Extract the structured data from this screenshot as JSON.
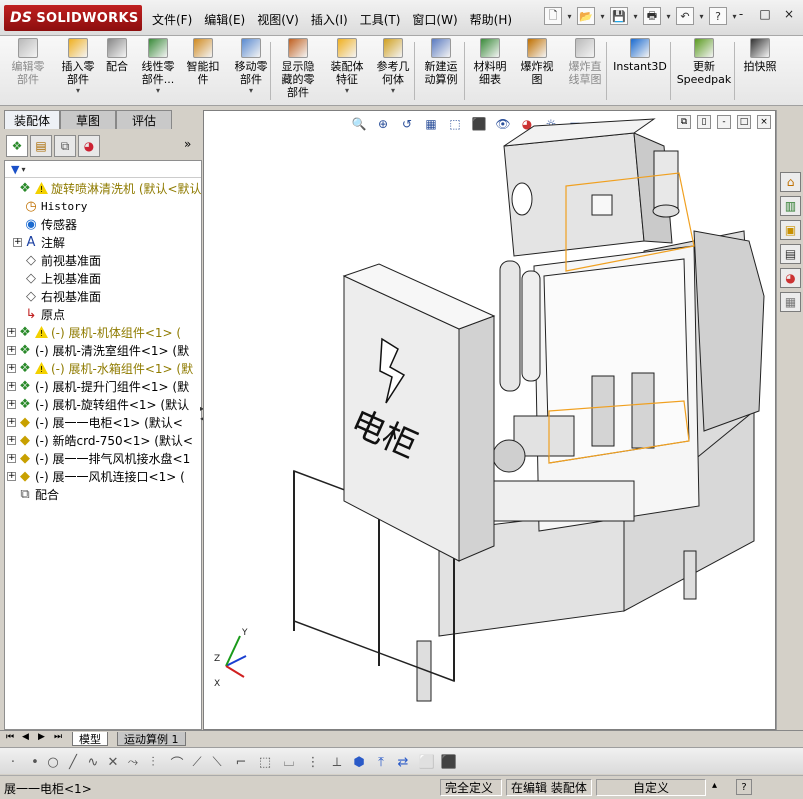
{
  "app": {
    "logo_text": "SOLIDWORKS",
    "logo_ds": "DS"
  },
  "menu": [
    "文件(F)",
    "编辑(E)",
    "视图(V)",
    "插入(I)",
    "工具(T)",
    "窗口(W)",
    "帮助(H)"
  ],
  "quick_icons": [
    "new-document-icon",
    "open-folder-icon",
    "save-icon",
    "print-icon",
    "undo-icon",
    "help-icon"
  ],
  "window_controls": [
    "?",
    "-",
    "□",
    "×"
  ],
  "command_manager": [
    {
      "label": "编辑零\n部件",
      "disabled": true,
      "dropdown": false
    },
    {
      "label": "插入零\n部件",
      "disabled": false,
      "dropdown": true
    },
    {
      "label": "配合",
      "disabled": false,
      "dropdown": false
    },
    {
      "label": "线性零\n部件...",
      "disabled": false,
      "dropdown": true
    },
    {
      "label": "智能扣\n件",
      "disabled": false,
      "dropdown": false
    },
    {
      "label": "移动零\n部件",
      "disabled": false,
      "dropdown": true
    },
    {
      "label": "显示隐\n藏的零\n部件",
      "disabled": false,
      "dropdown": false
    },
    {
      "label": "装配体\n特征",
      "disabled": false,
      "dropdown": true
    },
    {
      "label": "参考几\n何体",
      "disabled": false,
      "dropdown": true
    },
    {
      "label": "新建运\n动算例",
      "disabled": false,
      "dropdown": false
    },
    {
      "label": "材料明\n细表",
      "disabled": false,
      "dropdown": false
    },
    {
      "label": "爆炸视\n图",
      "disabled": false,
      "dropdown": false
    },
    {
      "label": "爆炸直\n线草图",
      "disabled": true,
      "dropdown": false
    },
    {
      "label": "Instant3D",
      "disabled": false,
      "dropdown": false
    },
    {
      "label": "更新\nSpeedpak",
      "disabled": false,
      "dropdown": false
    },
    {
      "label": "拍快照",
      "disabled": false,
      "dropdown": false
    }
  ],
  "left_tabs": [
    "装配体",
    "草图",
    "评估"
  ],
  "panel_more": "»",
  "tree": [
    {
      "label": "旋转喷淋清洗机  (默认<默认",
      "icon": "assembly-icon",
      "warn": true,
      "expand": false,
      "indent": 0,
      "style": "ylw"
    },
    {
      "label": "History",
      "icon": "history-icon",
      "warn": false,
      "expand": false,
      "indent": 1,
      "style": "mono"
    },
    {
      "label": "传感器",
      "icon": "sensor-icon",
      "warn": false,
      "expand": false,
      "indent": 1,
      "style": ""
    },
    {
      "label": "注解",
      "icon": "annotation-icon",
      "warn": false,
      "expand": true,
      "indent": 1,
      "style": ""
    },
    {
      "label": "前视基准面",
      "icon": "plane-icon",
      "warn": false,
      "expand": false,
      "indent": 1,
      "style": ""
    },
    {
      "label": "上视基准面",
      "icon": "plane-icon",
      "warn": false,
      "expand": false,
      "indent": 1,
      "style": ""
    },
    {
      "label": "右视基准面",
      "icon": "plane-icon",
      "warn": false,
      "expand": false,
      "indent": 1,
      "style": ""
    },
    {
      "label": "原点",
      "icon": "origin-icon",
      "warn": false,
      "expand": false,
      "indent": 1,
      "style": ""
    },
    {
      "label": "(-) 展机-机体组件<1> (",
      "icon": "subassembly-icon",
      "warn": true,
      "expand": true,
      "indent": 0,
      "style": "ylw"
    },
    {
      "label": "(-) 展机-清洗室组件<1> (默",
      "icon": "subassembly-icon",
      "warn": false,
      "expand": true,
      "indent": 0,
      "style": ""
    },
    {
      "label": "(-) 展机-水箱组件<1> (默",
      "icon": "subassembly-icon",
      "warn": true,
      "expand": true,
      "indent": 0,
      "style": "ylw"
    },
    {
      "label": "(-) 展机-提升门组件<1> (默",
      "icon": "subassembly-icon",
      "warn": false,
      "expand": true,
      "indent": 0,
      "style": ""
    },
    {
      "label": "(-) 展机-旋转组件<1> (默认",
      "icon": "subassembly-icon",
      "warn": false,
      "expand": true,
      "indent": 0,
      "style": ""
    },
    {
      "label": "(-) 展一一电柜<1> (默认<",
      "icon": "part-icon",
      "warn": false,
      "expand": true,
      "indent": 0,
      "style": ""
    },
    {
      "label": "(-) 新皓crd-750<1> (默认<",
      "icon": "part-icon",
      "warn": false,
      "expand": true,
      "indent": 0,
      "style": ""
    },
    {
      "label": "(-) 展一一排气风机接水盘<1",
      "icon": "part-icon",
      "warn": false,
      "expand": true,
      "indent": 0,
      "style": ""
    },
    {
      "label": "(-) 展一一风机连接口<1> (",
      "icon": "part-icon",
      "warn": false,
      "expand": true,
      "indent": 0,
      "style": ""
    },
    {
      "label": "配合",
      "icon": "mates-icon",
      "warn": false,
      "expand": false,
      "indent": 0,
      "style": ""
    }
  ],
  "bottom_tabs": [
    "模型",
    "运动算例 1"
  ],
  "model": {
    "cabinet_text": "电柜"
  },
  "status": {
    "selection": "展一一电柜<1>",
    "definition": "完全定义",
    "mode": "在编辑 装配体",
    "custom": "自定义"
  },
  "colors": {
    "brand_red": "#b01818",
    "warning_yellow": "#f3d100",
    "selection_orange": "#f0a020"
  }
}
